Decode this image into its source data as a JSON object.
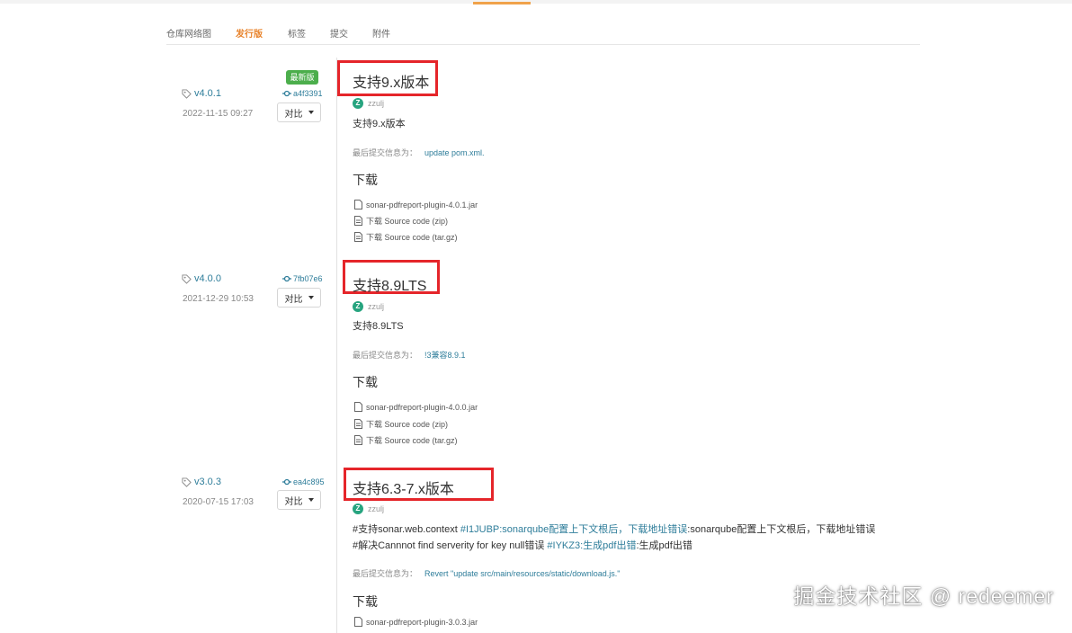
{
  "tabs": [
    {
      "label": "仓库网络图",
      "active": false
    },
    {
      "label": "发行版",
      "active": true
    },
    {
      "label": "标签",
      "active": false
    },
    {
      "label": "提交",
      "active": false
    },
    {
      "label": "附件",
      "active": false
    }
  ],
  "releases": [
    {
      "tag": "v4.0.1",
      "date": "2022-11-15 09:27",
      "latest_badge": "最新版",
      "commit": "a4f3391",
      "compare_label": "对比",
      "title": "支持9.x版本",
      "author_initial": "Z",
      "author": "zzulj",
      "description": "支持9.x版本",
      "last_commit_label": "最后提交信息为：",
      "last_commit_msg": "update pom.xml.",
      "download_title": "下载",
      "assets": [
        {
          "label": "sonar-pdfreport-plugin-4.0.1.jar",
          "icon": "file-icon"
        },
        {
          "label": "下载 Source code (zip)",
          "icon": "file-icon"
        },
        {
          "label": "下载 Source code (tar.gz)",
          "icon": "file-icon"
        }
      ]
    },
    {
      "tag": "v4.0.0",
      "date": "2021-12-29 10:53",
      "commit": "7fb07e6",
      "compare_label": "对比",
      "title": "支持8.9LTS",
      "author_initial": "Z",
      "author": "zzulj",
      "description": "支持8.9LTS",
      "last_commit_label": "最后提交信息为：",
      "last_commit_msg": "!3兼容8.9.1",
      "download_title": "下载",
      "assets": [
        {
          "label": "sonar-pdfreport-plugin-4.0.0.jar",
          "icon": "file-icon"
        },
        {
          "label": "下载 Source code (zip)",
          "icon": "file-icon"
        },
        {
          "label": "下载 Source code (tar.gz)",
          "icon": "file-icon"
        }
      ]
    },
    {
      "tag": "v3.0.3",
      "date": "2020-07-15 17:03",
      "commit": "ea4c895",
      "compare_label": "对比",
      "title": "支持6.3-7.x版本",
      "author_initial": "Z",
      "author": "zzulj",
      "desc_line1_a": "#支持sonar.web.context ",
      "desc_line1_link1": "#I1JUBP:sonarqube配置上下文根后，下载地址错误",
      "desc_line1_b": ":sonarqube配置上下文根后，下载地址错误",
      "desc_line2_a": "#解决Cannnot find serverity for key null错误 ",
      "desc_line2_link": "#IYKZ3:生成pdf出错",
      "desc_line2_b": ":生成pdf出错",
      "last_commit_label": "最后提交信息为：",
      "last_commit_msg": "Revert \"update src/main/resources/static/download.js.\"",
      "download_title": "下载",
      "assets": [
        {
          "label": "sonar-pdfreport-plugin-3.0.3.jar",
          "icon": "file-icon"
        }
      ]
    }
  ],
  "watermark": "掘金技术社区 @ redeemer",
  "colors": {
    "accent": "#e8832b",
    "link": "#2e7d9a",
    "latest_badge": "#4cae4c",
    "annotation_box": "#e5252a",
    "avatar": "#27a47f"
  }
}
